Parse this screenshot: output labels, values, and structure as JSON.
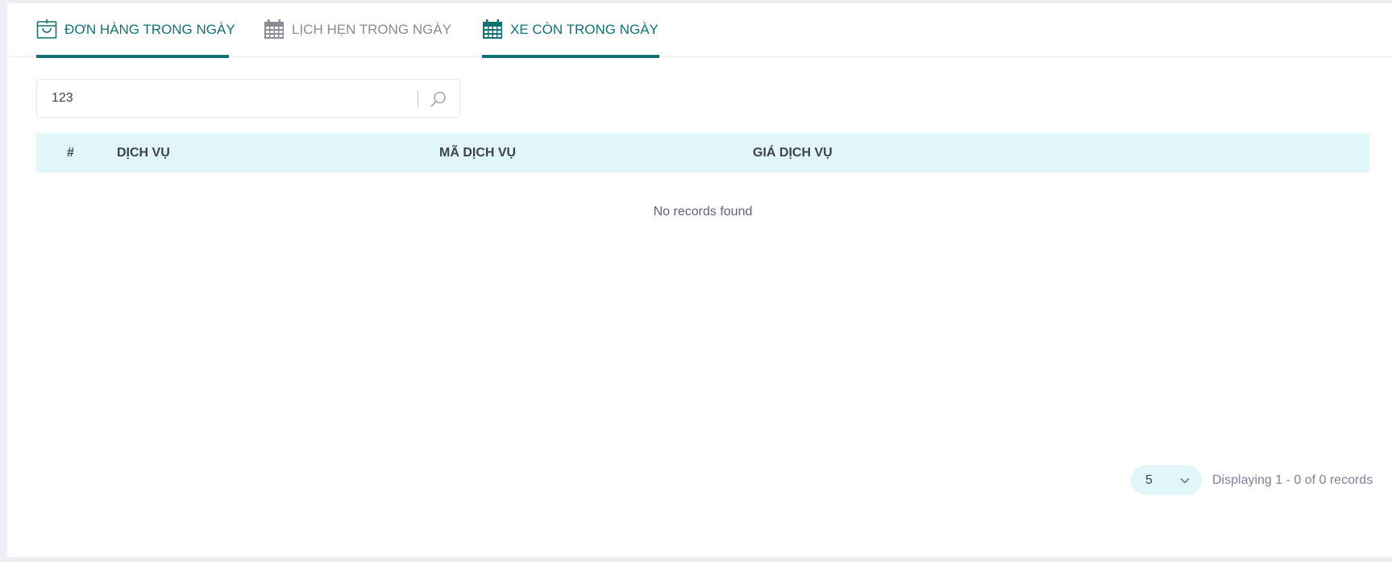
{
  "tabs": [
    {
      "label": "ĐƠN HÀNG TRONG NGÀY",
      "icon": "shopping-bag-icon",
      "active": true
    },
    {
      "label": "LỊCH HẸN TRONG NGÀY",
      "icon": "calendar-icon",
      "active": false
    },
    {
      "label": "XE CÒN TRONG NGÀY",
      "icon": "calendar-icon",
      "active": true
    }
  ],
  "search": {
    "value": "123",
    "icon": "search-icon"
  },
  "table": {
    "columns": [
      "#",
      "DỊCH VỤ",
      "MÃ DỊCH VỤ",
      "GIÁ DỊCH VỤ"
    ],
    "rows": [],
    "empty_text": "No records found"
  },
  "pagination": {
    "page_size": "5",
    "info": "Displaying 1 - 0 of 0 records"
  },
  "colors": {
    "accent": "#127173",
    "header_bg": "#e0f6f9",
    "inactive_tab": "#8a8b94",
    "page_bg": "#eeeef4"
  }
}
